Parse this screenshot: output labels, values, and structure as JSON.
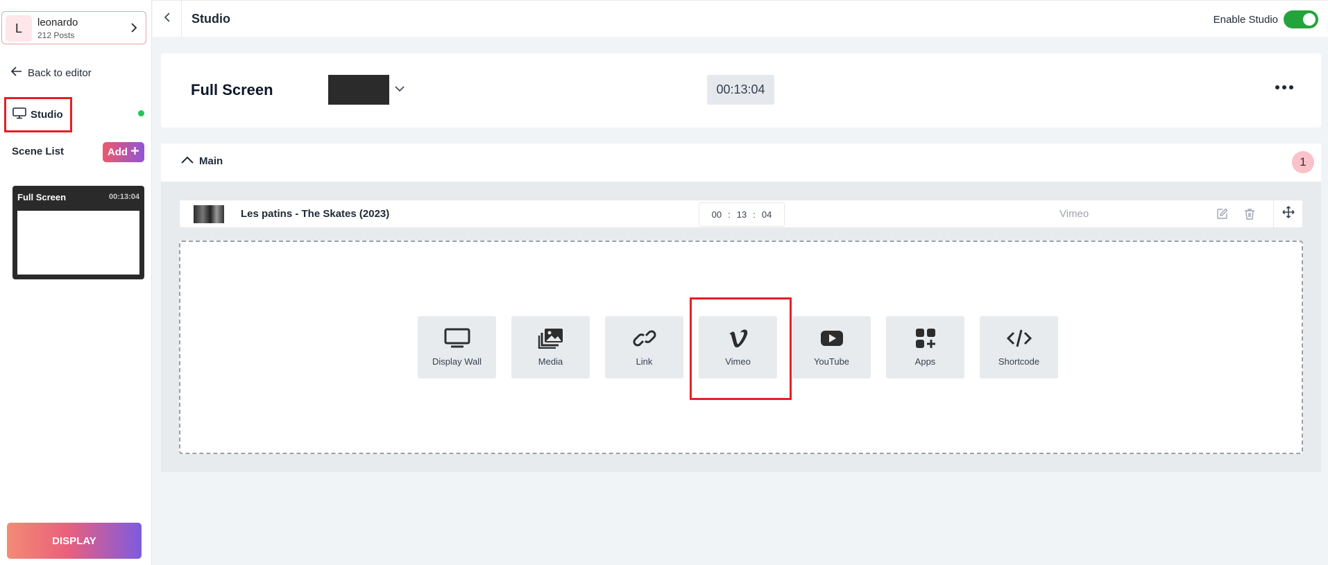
{
  "account": {
    "initial": "L",
    "name": "leonardo",
    "posts": "212 Posts"
  },
  "sidebar": {
    "back_label": "Back to editor",
    "studio_label": "Studio",
    "scene_list_label": "Scene List",
    "add_label": "Add",
    "display_label": "DISPLAY"
  },
  "scenes": [
    {
      "title": "Full Screen",
      "duration": "00:13:04"
    }
  ],
  "topbar": {
    "title": "Studio",
    "enable_label": "Enable Studio",
    "enabled": true
  },
  "scene_header": {
    "name": "Full Screen",
    "swatch_color": "#2b2b2b",
    "duration": "00:13:04"
  },
  "main": {
    "label": "Main",
    "count": "1",
    "items": [
      {
        "title": "Les patins - The Skates (2023)",
        "hh": "00",
        "mm": "13",
        "ss": "04",
        "source": "Vimeo"
      }
    ],
    "tiles": [
      {
        "label": "Display Wall",
        "icon": "monitor-icon"
      },
      {
        "label": "Media",
        "icon": "images-icon"
      },
      {
        "label": "Link",
        "icon": "link-icon"
      },
      {
        "label": "Vimeo",
        "icon": "vimeo-icon"
      },
      {
        "label": "YouTube",
        "icon": "youtube-icon"
      },
      {
        "label": "Apps",
        "icon": "apps-icon"
      },
      {
        "label": "Shortcode",
        "icon": "code-icon"
      }
    ]
  },
  "colors": {
    "accent_green": "#22a43a",
    "highlight_red": "#e61f26"
  }
}
